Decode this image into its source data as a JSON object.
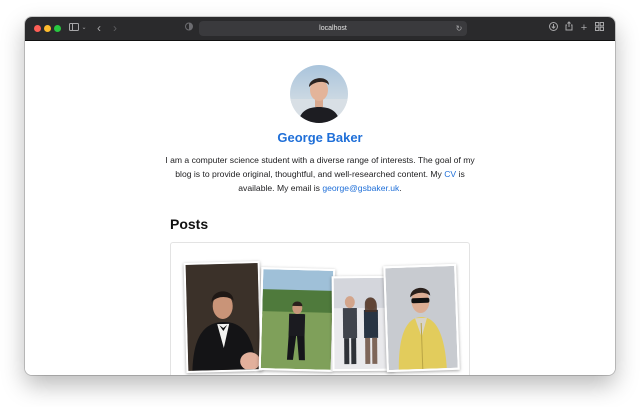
{
  "browser": {
    "url": "localhost",
    "colors": {
      "close": "#fe5f57",
      "minimize": "#febc2e",
      "zoom": "#28c840"
    }
  },
  "profile": {
    "name": "George Baker",
    "bio_part1": "I am a computer science student with a diverse range of interests. The goal of my blog is to provide original, thoughtful, and well-researched content. My ",
    "cv_link": "CV",
    "bio_part2": " is available. My email is ",
    "email": "george@gsbaker.uk",
    "bio_end": "."
  },
  "posts": {
    "heading": "Posts"
  },
  "accent_color": "#1f6fd8"
}
